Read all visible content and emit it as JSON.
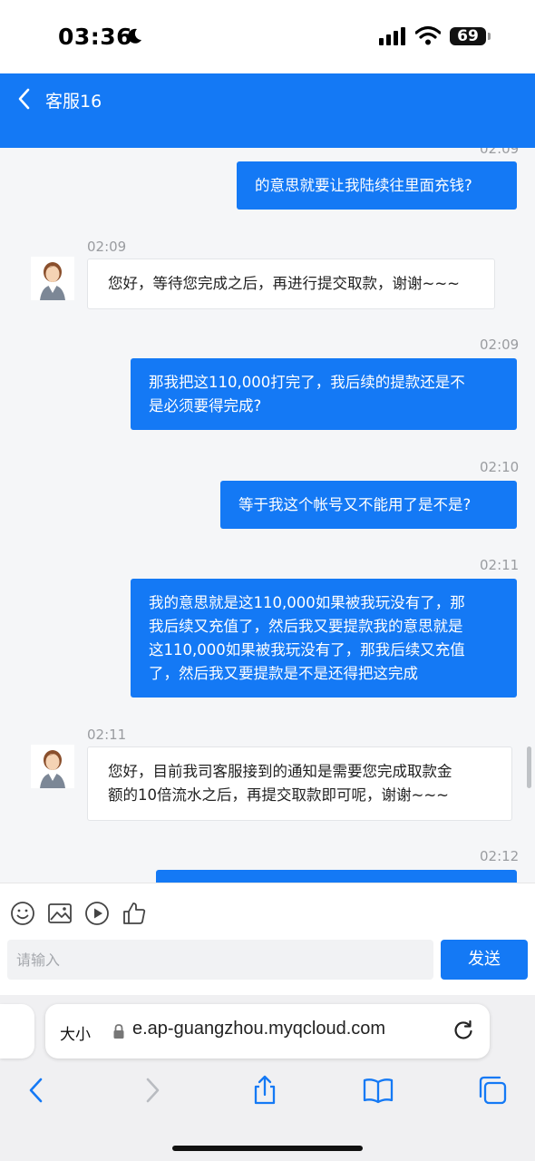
{
  "status_bar": {
    "time": "03:36",
    "battery": "69"
  },
  "header": {
    "title": "客服16"
  },
  "chat": {
    "partial_top_time": "02:09",
    "messages": [
      {
        "side": "out",
        "time": "",
        "text": "的意思就要让我陆续往里面充钱?"
      },
      {
        "side": "in",
        "time": "02:09",
        "text": "您好，等待您完成之后，再进行提交取款，谢谢~~~"
      },
      {
        "side": "out",
        "time": "02:09",
        "lines": [
          "那我把这110,000打完了，我后续的提款还是不",
          "是必须要得完成?"
        ]
      },
      {
        "side": "out",
        "time": "02:10",
        "text": "等于我这个帐号又不能用了是不是?"
      },
      {
        "side": "out",
        "time": "02:11",
        "lines": [
          "我的意思就是这110,000如果被我玩没有了，那",
          "我后续又充值了，然后我又要提款我的意思就是",
          "这110,000如果被我玩没有了，那我后续又充值",
          "了，然后我又要提款是不是还得把这完成"
        ]
      },
      {
        "side": "in",
        "time": "02:11",
        "lines": [
          "您好，目前我司客服接到的通知是需要您完成取款金",
          "额的10倍流水之后，再提交取款即可呢，谢谢~~~"
        ]
      },
      {
        "side": "out",
        "time": "02:12",
        "text": ""
      }
    ]
  },
  "composer": {
    "placeholder": "请输入",
    "send_label": "发送"
  },
  "safari": {
    "aa_label": "大小",
    "url": "e.ap-guangzhou.myqcloud.com"
  },
  "colors": {
    "accent": "#1479f5"
  }
}
